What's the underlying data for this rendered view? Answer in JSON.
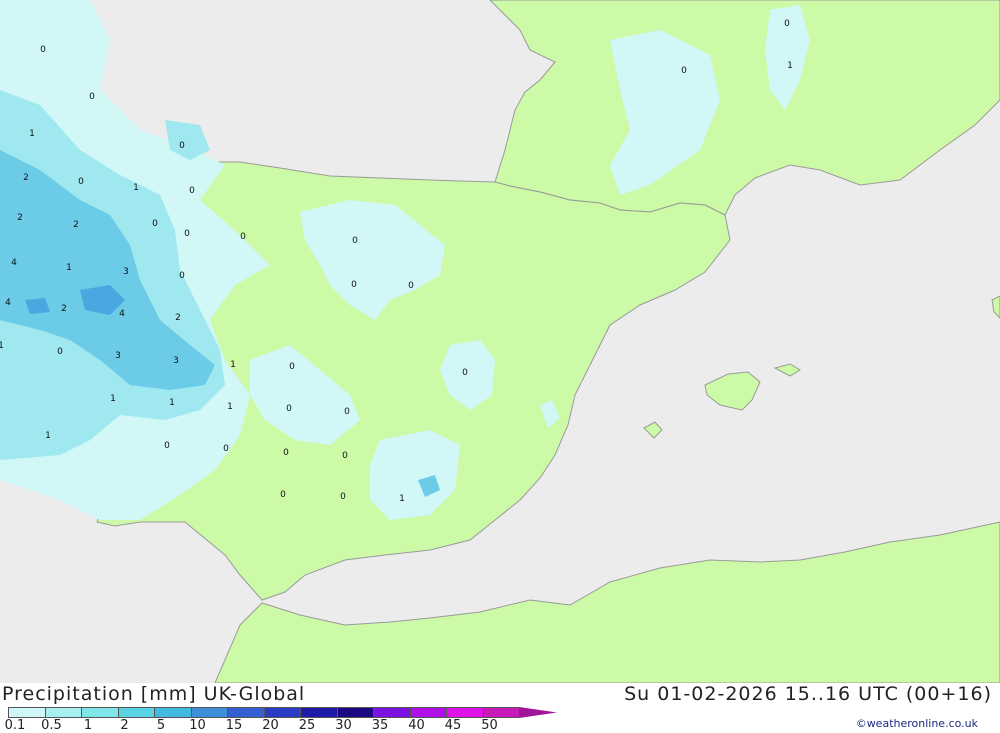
{
  "legend": {
    "title": "Precipitation [mm]  UK-Global",
    "timestamp": "Su 01-02-2026 15..16 UTC (00+16)",
    "credit": "©weatheronline.co.uk",
    "ticks": [
      "0.1",
      "0.5",
      "1",
      "2",
      "5",
      "10",
      "15",
      "20",
      "25",
      "30",
      "35",
      "40",
      "45",
      "50"
    ],
    "colors": [
      "#cff7f7",
      "#a8f0f0",
      "#7fe6ea",
      "#5ad3e4",
      "#43b8e0",
      "#3d8fd8",
      "#3560d0",
      "#2a3bc4",
      "#1f1aa8",
      "#1a0880",
      "#7b12e0",
      "#b010e8",
      "#e012e8",
      "#c81ab8",
      "#a0169a"
    ]
  },
  "map": {
    "colors": {
      "sea": "#ececec",
      "land": "#ccfaa6",
      "border": "#9a9a9a",
      "light_precip": "#d2f7f7",
      "mid_precip": "#9fe8ef",
      "heavy_precip": "#6ccbe6",
      "heaviest_precip": "#4ba7e0"
    },
    "values": [
      "0",
      "1",
      "0",
      "0",
      "1",
      "2",
      "0",
      "1",
      "0",
      "2",
      "2",
      "0",
      "0",
      "0",
      "4",
      "1",
      "3",
      "0",
      "0",
      "0",
      "4",
      "2",
      "4",
      "2",
      "1",
      "0",
      "3",
      "3",
      "1",
      "0",
      "0",
      "1",
      "1",
      "1",
      "0",
      "0",
      "1",
      "0",
      "0",
      "0",
      "0",
      "0",
      "0",
      "1",
      "0",
      "0",
      "0"
    ]
  }
}
